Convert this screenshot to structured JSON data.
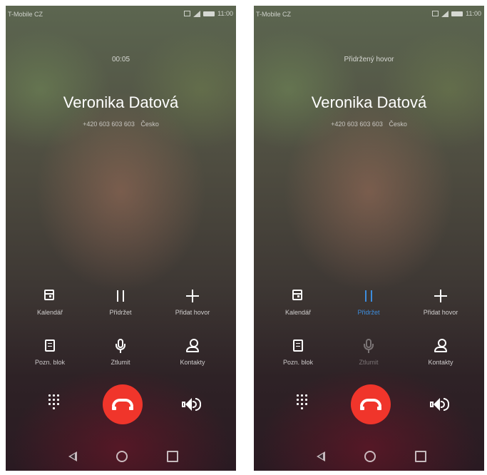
{
  "screens": [
    {
      "carrier": "T-Mobile CZ",
      "time": "11:00",
      "call_status": "00:05",
      "caller_name": "Veronika Datová",
      "caller_number": "+420 603 603 603",
      "caller_country": "Česko",
      "buttons": {
        "calendar": "Kalendář",
        "hold": "Přidržet",
        "add_call": "Přidat hovor",
        "notepad": "Pozn. blok",
        "mute": "Ztlumit",
        "contacts": "Kontakty"
      },
      "hold_active": false,
      "mute_enabled": true
    },
    {
      "carrier": "T-Mobile CZ",
      "time": "11:00",
      "call_status": "Přidržený hovor",
      "caller_name": "Veronika Datová",
      "caller_number": "+420 603 603 603",
      "caller_country": "Česko",
      "buttons": {
        "calendar": "Kalendář",
        "hold": "Přidržet",
        "add_call": "Přidat hovor",
        "notepad": "Pozn. blok",
        "mute": "Ztlumit",
        "contacts": "Kontakty"
      },
      "hold_active": true,
      "mute_enabled": false
    }
  ],
  "colors": {
    "hangup": "#f0352b",
    "active_blue": "#3d8ddd"
  }
}
